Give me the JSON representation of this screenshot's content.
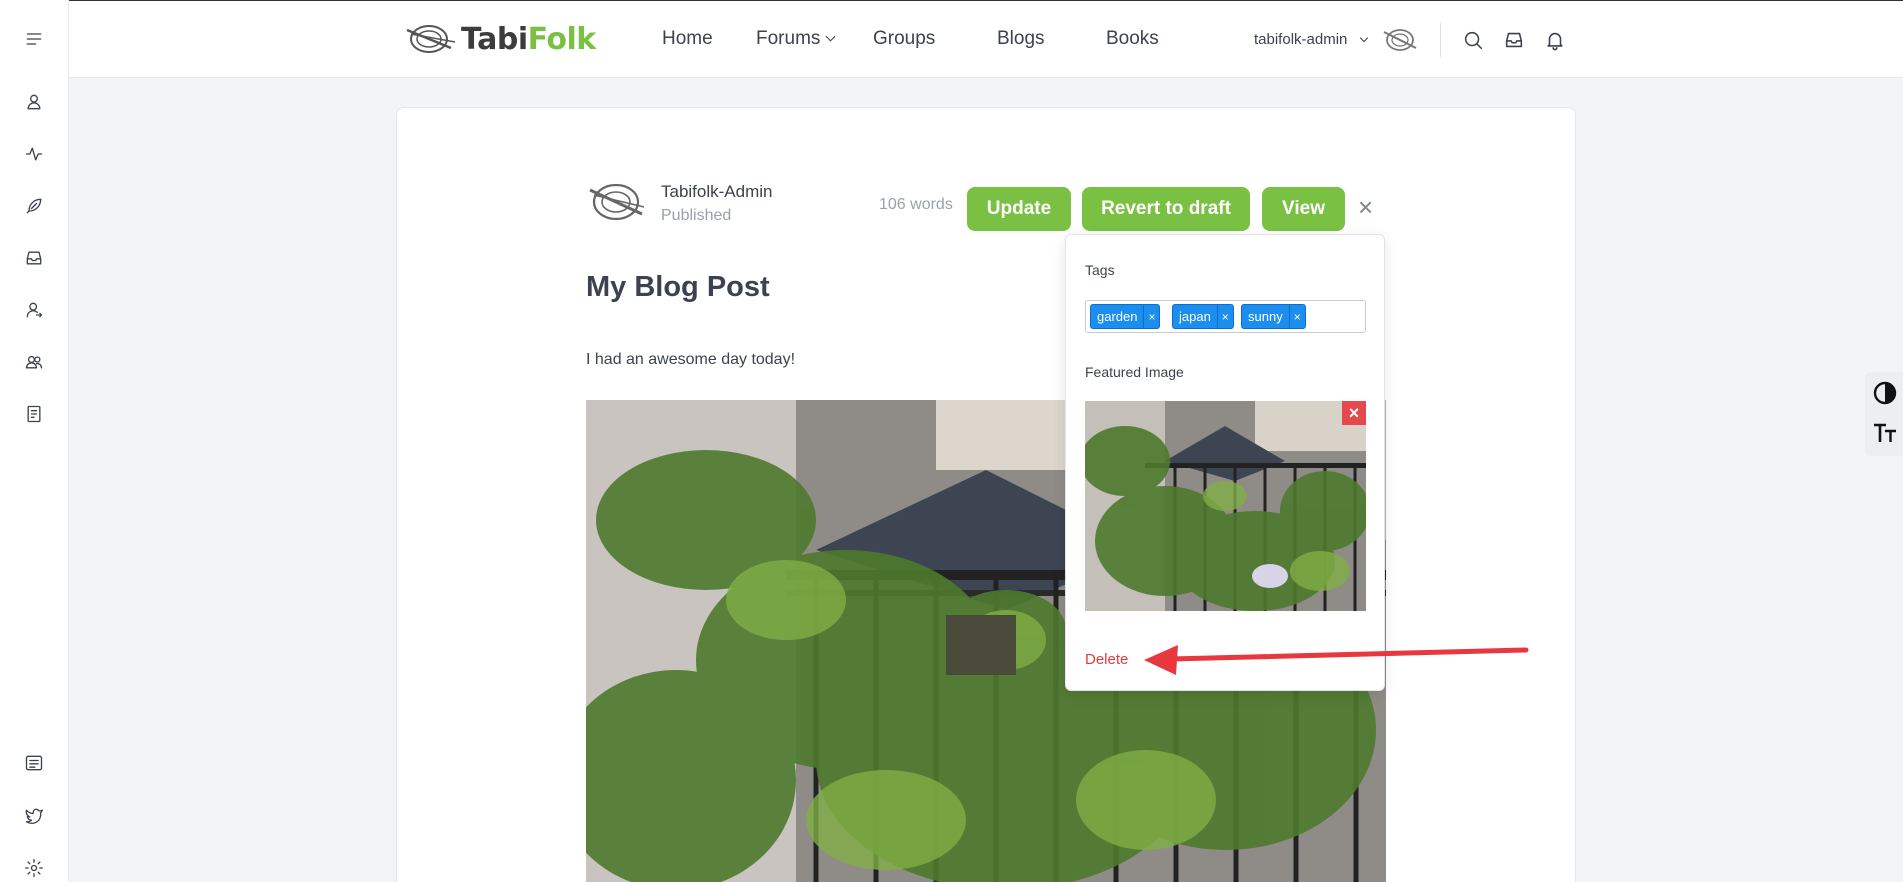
{
  "header": {
    "logo_text_part1": "Tabi",
    "logo_text_part2": "Folk",
    "nav": [
      {
        "label": "Home"
      },
      {
        "label": "Forums"
      },
      {
        "label": "Groups"
      },
      {
        "label": "Blogs"
      },
      {
        "label": "Books"
      }
    ],
    "username": "tabifolk-admin",
    "icons": [
      "search-icon",
      "inbox-icon",
      "bell-icon"
    ]
  },
  "sidebar": {
    "icons": [
      "menu-icon",
      "user-icon",
      "activity-icon",
      "feather-icon",
      "inbox-icon",
      "user-switch-icon",
      "users-icon",
      "book-icon",
      "list-icon",
      "twitter-icon",
      "gear-icon"
    ]
  },
  "editor": {
    "author_name": "Tabifolk-Admin",
    "status": "Published",
    "word_count": "106 words",
    "buttons": {
      "update": "Update",
      "revert": "Revert to draft",
      "view": "View"
    },
    "close_label": "×",
    "post_title": "My Blog Post",
    "post_body": "I had an awesome day today!"
  },
  "settings_panel": {
    "tags_label": "Tags",
    "tags": [
      {
        "label": "garden",
        "remove": "×"
      },
      {
        "label": "japan",
        "remove": "×"
      },
      {
        "label": "sunny",
        "remove": "×"
      }
    ],
    "featured_label": "Featured Image",
    "remove_image_label": "×",
    "delete_label": "Delete"
  },
  "colors": {
    "brand_green": "#7ac143",
    "tag_blue": "#1c8ef0",
    "delete_red": "#e33b3b",
    "arrow_red": "#e8383d"
  }
}
